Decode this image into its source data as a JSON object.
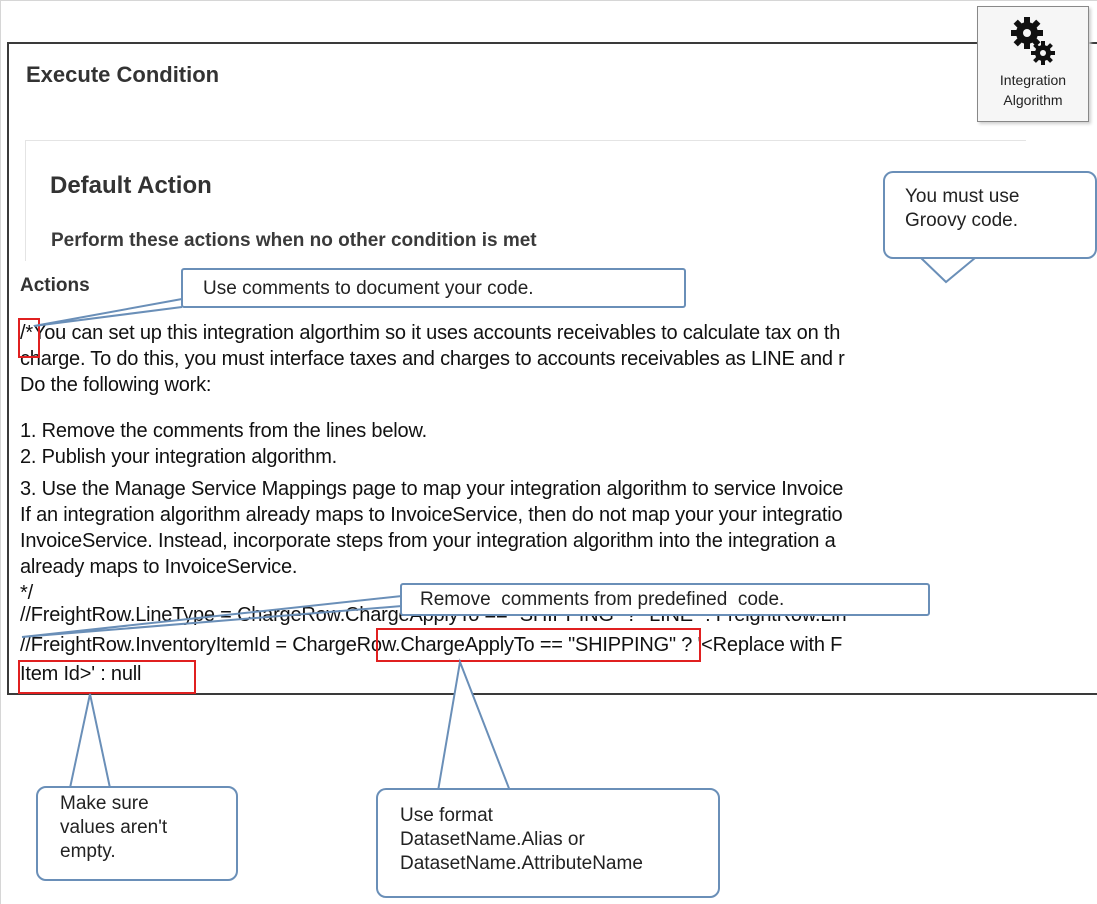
{
  "window": {
    "title": "Execute Condition",
    "integration_button": {
      "icon": "gears-icon",
      "line1": "Integration",
      "line2": "Algorithm"
    }
  },
  "default_action": {
    "title": "Default Action",
    "description": "Perform these actions when no other condition is met"
  },
  "actions_label": "Actions",
  "code_lines": [
    "/*You can set up this integration algorthim so it uses accounts receivables to calculate tax on th",
    "charge. To do this, you must interface taxes and charges to accounts receivables as LINE and r",
    "Do the following work:",
    "1. Remove the comments from the lines below.",
    "2. Publish your integration algorithm.",
    "3. Use the Manage Service Mappings page to map your integration algorithm to service Invoice",
    "If an integration algorithm already maps to InvoiceService, then do not map your your integratio",
    "InvoiceService. Instead, incorporate steps from your integration algorithm into the integration a",
    "already maps to InvoiceService.",
    "*/",
    "//FreightRow.LineType = ChargeRow.ChargeApplyTo == \"SHIPPING\" ? \"LINE\" : FreightRow.Lin",
    "//FreightRow.InventoryItemId = ChargeRow.ChargeApplyTo == \"SHIPPING\" ? '<Replace with F",
    "Item Id>' : null"
  ],
  "callouts": {
    "groovy": {
      "line1": "You must use",
      "line2": "Groovy code."
    },
    "comments": "Use comments to document your code.",
    "remove": "Remove  comments from predefined  code.",
    "empty": {
      "line1": "Make sure",
      "line2": "values aren't",
      "line3": "empty."
    },
    "format": {
      "line1": "Use format",
      "line2": "DatasetName.Alias or",
      "line3": "DatasetName.AttributeName"
    }
  },
  "colors": {
    "callout_border": "#6a8fb8",
    "highlight": "#e02020",
    "panel_border": "#3a3a3a"
  }
}
